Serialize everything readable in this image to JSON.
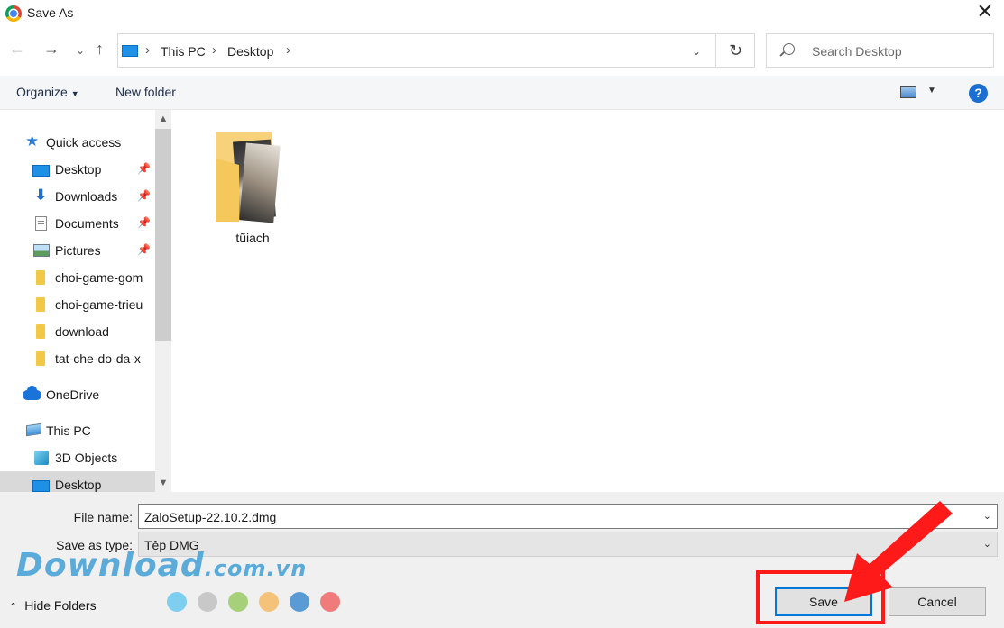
{
  "window": {
    "title": "Save As"
  },
  "nav": {
    "breadcrumb": [
      "This PC",
      "Desktop"
    ],
    "search_placeholder": "Search Desktop"
  },
  "toolbar": {
    "organize": "Organize",
    "new_folder": "New folder"
  },
  "sidebar": {
    "items": [
      {
        "label": "Quick access",
        "icon": "star-icon"
      },
      {
        "label": "Desktop",
        "icon": "desktop-icon",
        "pinned": true
      },
      {
        "label": "Downloads",
        "icon": "download-icon",
        "pinned": true
      },
      {
        "label": "Documents",
        "icon": "documents-icon",
        "pinned": true
      },
      {
        "label": "Pictures",
        "icon": "pictures-icon",
        "pinned": true
      },
      {
        "label": "choi-game-gom",
        "icon": "folder-icon"
      },
      {
        "label": "choi-game-trieu",
        "icon": "folder-icon"
      },
      {
        "label": "download",
        "icon": "folder-icon"
      },
      {
        "label": "tat-che-do-da-x",
        "icon": "folder-icon"
      },
      {
        "label": "OneDrive",
        "icon": "cloud-icon"
      },
      {
        "label": "This PC",
        "icon": "computer-icon"
      },
      {
        "label": "3D Objects",
        "icon": "3d-objects-icon"
      },
      {
        "label": "Desktop",
        "icon": "desktop-icon",
        "selected": true
      }
    ]
  },
  "content": {
    "items": [
      {
        "name": "tũiach",
        "type": "folder"
      }
    ]
  },
  "form": {
    "file_name_label": "File name:",
    "file_name_value": "ZaloSetup-22.10.2.dmg",
    "save_type_label": "Save as type:",
    "save_type_value": "Tệp DMG"
  },
  "footer": {
    "hide_folders": "Hide Folders",
    "save": "Save",
    "cancel": "Cancel"
  },
  "watermark": {
    "brand": "Download",
    "domain": ".com.vn",
    "dot_colors": [
      "#7ecef0",
      "#c8c8c8",
      "#a6d07a",
      "#f5c27a",
      "#5b9bd5",
      "#ef7b7b"
    ]
  },
  "colors": {
    "accent": "#0078d7",
    "highlight": "#ff1a1a"
  }
}
